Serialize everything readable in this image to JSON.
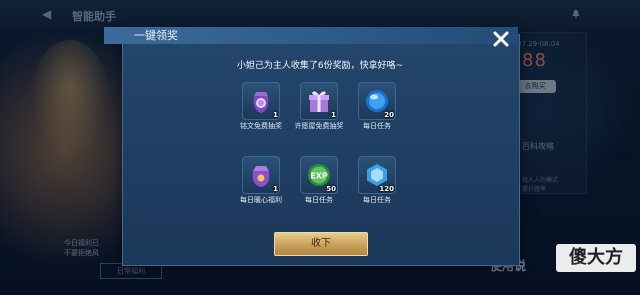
{
  "background": {
    "title": "智能助手",
    "date_range": "07.29-08.04",
    "big_number": "88",
    "buy_button": "去购买",
    "strategy_label": "百科攻略",
    "promo_text": "找人人的模式\n提升胜率",
    "bottom_notice": "今日福利已\n不要拒绝风",
    "bottom_button": "日常福利",
    "usage_label": "使用说"
  },
  "modal": {
    "title": "一键领奖",
    "message": "小妲己为主人收集了6份奖励，快拿好咯~",
    "collect_button": "收下"
  },
  "rewards": [
    {
      "label": "铭文免费抽奖",
      "count": "1",
      "icon": "purple-bag-gem-icon"
    },
    {
      "label": "许愿屋免费抽奖",
      "count": "1",
      "icon": "gift-box-icon"
    },
    {
      "label": "每日任务",
      "count": "20",
      "icon": "blue-orb-icon"
    },
    {
      "label": "每日暖心福利",
      "count": "1",
      "icon": "purple-bag-icon"
    },
    {
      "label": "每日任务",
      "count": "50",
      "icon": "exp-orb-icon"
    },
    {
      "label": "每日任务",
      "count": "120",
      "icon": "crystal-hexagon-icon"
    }
  ],
  "watermark": "傻大方",
  "colors": {
    "modal_bg": "#22426a",
    "header_bg": "#3c6b9b",
    "button_gold": "#c9a059"
  }
}
